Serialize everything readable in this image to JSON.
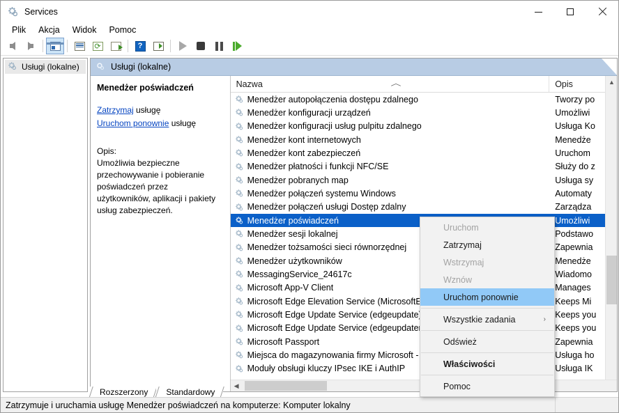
{
  "window": {
    "title": "Services",
    "title_icon": "services-gear-icon",
    "minimize": "–",
    "maximize": "□",
    "close": "✕"
  },
  "menubar": {
    "items": [
      {
        "label": "Plik",
        "name": "menu-file"
      },
      {
        "label": "Akcja",
        "name": "menu-action"
      },
      {
        "label": "Widok",
        "name": "menu-view"
      },
      {
        "label": "Pomoc",
        "name": "menu-help"
      }
    ]
  },
  "toolbar": {
    "buttons": [
      {
        "name": "back-arrow-icon",
        "kind": "back"
      },
      {
        "name": "forward-arrow-icon",
        "kind": "forward"
      },
      {
        "name": "show-hide-console-tree-icon",
        "kind": "pane",
        "selected": true
      },
      {
        "name": "properties-icon",
        "kind": "list"
      },
      {
        "name": "refresh-icon",
        "kind": "refresh"
      },
      {
        "name": "export-list-icon",
        "kind": "export"
      },
      {
        "name": "help-icon",
        "kind": "help"
      },
      {
        "name": "show-action-pane-icon",
        "kind": "showhide"
      },
      {
        "name": "start-service-icon",
        "kind": "play"
      },
      {
        "name": "stop-service-icon",
        "kind": "stop"
      },
      {
        "name": "pause-service-icon",
        "kind": "pause"
      },
      {
        "name": "restart-service-icon",
        "kind": "restart"
      }
    ]
  },
  "tree": {
    "root_label": "Usługi (lokalne)"
  },
  "pane": {
    "header_label": "Usługi (lokalne)"
  },
  "details": {
    "service_title": "Menedżer poświadczeń",
    "stop_link": "Zatrzymaj",
    "stop_suffix": " usługę",
    "restart_link": "Uruchom ponownie",
    "restart_suffix": " usługę",
    "desc_label": "Opis:",
    "desc_text": "Umożliwia bezpieczne przechowywanie i pobieranie poświadczeń przez użytkowników, aplikacji i pakiety usług zabezpieczeń."
  },
  "list": {
    "columns": [
      {
        "label": "Nazwa",
        "name": "column-header-name",
        "sorted": true
      },
      {
        "label": "Opis",
        "name": "column-header-description",
        "sorted": false
      }
    ],
    "rows": [
      {
        "name": "Menedżer autopołączenia dostępu zdalnego",
        "desc": "Tworzy po"
      },
      {
        "name": "Menedżer konfiguracji urządzeń",
        "desc": "Umożliwi"
      },
      {
        "name": "Menedżer konfiguracji usług pulpitu zdalnego",
        "desc": "Usługa Ko"
      },
      {
        "name": "Menedżer kont internetowych",
        "desc": "Menedże"
      },
      {
        "name": "Menedżer kont zabezpieczeń",
        "desc": "Uruchom"
      },
      {
        "name": "Menedżer płatności i funkcji NFC/SE",
        "desc": "Służy do z"
      },
      {
        "name": "Menedżer pobranych map",
        "desc": "Usługa sy"
      },
      {
        "name": "Menedżer połączeń systemu Windows",
        "desc": "Automaty"
      },
      {
        "name": "Menedżer połączeń usługi Dostęp zdalny",
        "desc": "Zarządza"
      },
      {
        "name": "Menedżer poświadczeń",
        "desc": "Umożliwi",
        "selected": true
      },
      {
        "name": "Menedżer sesji lokalnej",
        "desc": "Podstawo"
      },
      {
        "name": "Menedżer tożsamości sieci równorzędnej",
        "desc": "Zapewnia"
      },
      {
        "name": "Menedżer użytkowników",
        "desc": "Menedże"
      },
      {
        "name": "MessagingService_24617c",
        "desc": "Wiadomo"
      },
      {
        "name": "Microsoft App-V Client",
        "desc": "Manages"
      },
      {
        "name": "Microsoft Edge Elevation Service (MicrosoftEd",
        "desc": "Keeps Mi"
      },
      {
        "name": "Microsoft Edge Update Service (edgeupdate)",
        "desc": "Keeps you"
      },
      {
        "name": "Microsoft Edge Update Service (edgeupdatem",
        "desc": "Keeps you"
      },
      {
        "name": "Microsoft Passport",
        "desc": "Zapewnia"
      },
      {
        "name": "Miejsca do magazynowania firmy Microsoft -",
        "desc": "Usługa ho"
      },
      {
        "name": "Moduły obsługi kluczy IPsec IKE i AuthIP",
        "desc": "Usługa IK"
      }
    ]
  },
  "context_menu": {
    "items": [
      {
        "label": "Uruchom",
        "state": "disabled",
        "name": "ctx-start"
      },
      {
        "label": "Zatrzymaj",
        "state": "normal",
        "name": "ctx-stop"
      },
      {
        "label": "Wstrzymaj",
        "state": "disabled",
        "name": "ctx-pause"
      },
      {
        "label": "Wznów",
        "state": "disabled",
        "name": "ctx-resume"
      },
      {
        "label": "Uruchom ponownie",
        "state": "highlighted",
        "name": "ctx-restart"
      },
      {
        "label": "Wszystkie zadania",
        "state": "submenu",
        "name": "ctx-all-tasks",
        "submark": "›"
      },
      {
        "label": "Odśwież",
        "state": "normal",
        "name": "ctx-refresh"
      },
      {
        "label": "Właściwości",
        "state": "bold",
        "name": "ctx-properties"
      },
      {
        "label": "Pomoc",
        "state": "normal",
        "name": "ctx-help"
      }
    ]
  },
  "tabs": [
    {
      "label": "Rozszerzony",
      "name": "tab-extended"
    },
    {
      "label": "Standardowy",
      "name": "tab-standard"
    }
  ],
  "statusbar": {
    "text": "Zatrzymuje i uruchamia usługę Menedżer poświadczeń na komputerze: Komputer lokalny"
  },
  "colors": {
    "selection_blue": "#0b60c8",
    "menu_highlight": "#91c9f7",
    "pane_header": "#b8cce4",
    "link": "#0645c1"
  }
}
